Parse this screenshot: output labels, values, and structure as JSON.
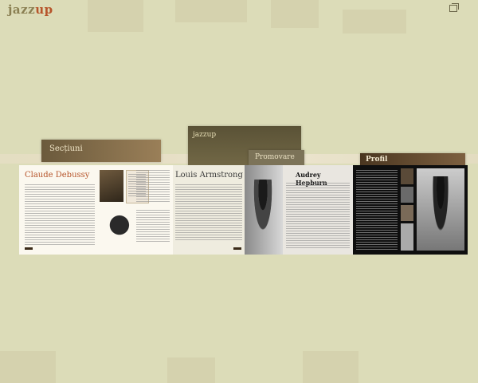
{
  "app": {
    "logo_part1": "jazz",
    "logo_part2": "up",
    "restore_icon": "restore-window-icon"
  },
  "background_cards": {
    "sectiuni": "Secțiuni",
    "jazzbook": "jazzup",
    "promovare": "Promovare",
    "profil": "Profil"
  },
  "pages": {
    "debussy": {
      "title": "Claude Debussy"
    },
    "armstrong": {
      "title": "Louis Armstrong"
    },
    "hepburn": {
      "title": "Audrey Hepburn"
    }
  },
  "colors": {
    "background": "#dcdcb8",
    "accent": "#b6542a"
  }
}
